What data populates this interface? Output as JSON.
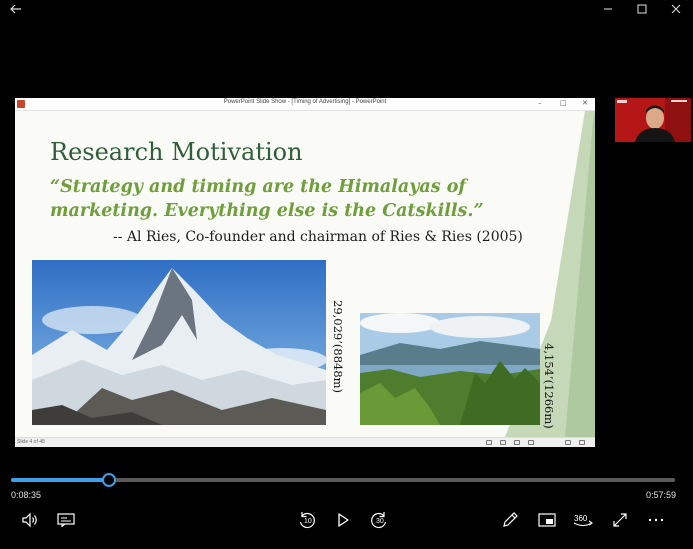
{
  "window": {
    "back_icon": "back-arrow-icon",
    "minimize_icon": "minimize-icon",
    "maximize_icon": "maximize-icon",
    "close_icon": "close-icon"
  },
  "presentation": {
    "window_title": "PowerPoint Slide Show - [Timing of Advertising] - PowerPoint",
    "slide": {
      "heading": "Research Motivation",
      "quote": "“Strategy and timing are the Himalayas of marketing. Everything else is the Catskills.”",
      "attribution": "-- Al Ries, Co-founder and chairman of Ries & Ries (2005)",
      "image1_label": "29,029’(8848m)",
      "image2_label": "4,154’(1266m)"
    },
    "status": {
      "slide_counter": "Slide 4 of 48"
    },
    "accent_color": "#2e5f39",
    "quote_color": "#6e9f3a"
  },
  "player": {
    "current_time": "0:08:35",
    "total_time": "0:57:59",
    "progress_fraction": 0.148,
    "skip_back_label": "10",
    "skip_forward_label": "30",
    "accent_color": "#3d9eea",
    "icons": [
      "volume-icon",
      "captions-icon",
      "skip-back-icon",
      "play-icon",
      "skip-forward-icon",
      "edit-pen-icon",
      "mini-view-icon",
      "360-view-icon",
      "fullscreen-icon",
      "more-options-icon"
    ]
  }
}
